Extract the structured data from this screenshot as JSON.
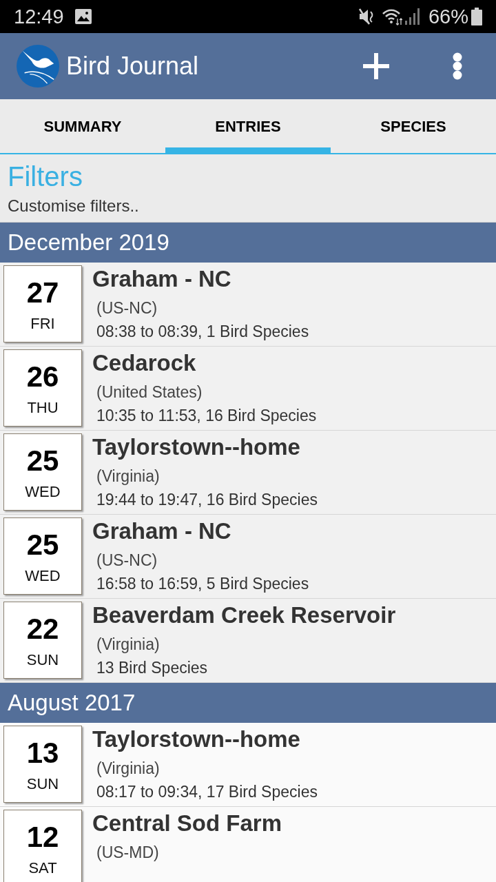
{
  "status_bar": {
    "time": "12:49",
    "battery": "66%"
  },
  "app_bar": {
    "title": "Bird Journal"
  },
  "tabs": [
    {
      "label": "SUMMARY",
      "selected": false
    },
    {
      "label": "ENTRIES",
      "selected": true
    },
    {
      "label": "SPECIES",
      "selected": false
    }
  ],
  "filters": {
    "title": "Filters",
    "subtitle": "Customise filters.."
  },
  "groups": [
    {
      "month": "December 2019",
      "entries": [
        {
          "day": "27",
          "weekday": "FRI",
          "location": "Graham - NC",
          "region": "(US-NC)",
          "details": "08:38 to 08:39, 1 Bird Species"
        },
        {
          "day": "26",
          "weekday": "THU",
          "location": "Cedarock",
          "region": "(United States)",
          "details": "10:35 to 11:53, 16 Bird Species"
        },
        {
          "day": "25",
          "weekday": "WED",
          "location": "Taylorstown--home",
          "region": "(Virginia)",
          "details": "19:44 to 19:47, 16 Bird Species"
        },
        {
          "day": "25",
          "weekday": "WED",
          "location": "Graham - NC",
          "region": "(US-NC)",
          "details": "16:58 to 16:59, 5 Bird Species"
        },
        {
          "day": "22",
          "weekday": "SUN",
          "location": "Beaverdam Creek Reservoir",
          "region": "(Virginia)",
          "details": "13 Bird Species"
        }
      ]
    },
    {
      "month": "August 2017",
      "entries": [
        {
          "day": "13",
          "weekday": "SUN",
          "location": "Taylorstown--home",
          "region": "(Virginia)",
          "details": "08:17 to 09:34, 17 Bird Species"
        },
        {
          "day": "12",
          "weekday": "SAT",
          "location": "Central Sod Farm",
          "region": "(US-MD)"
        }
      ]
    }
  ]
}
